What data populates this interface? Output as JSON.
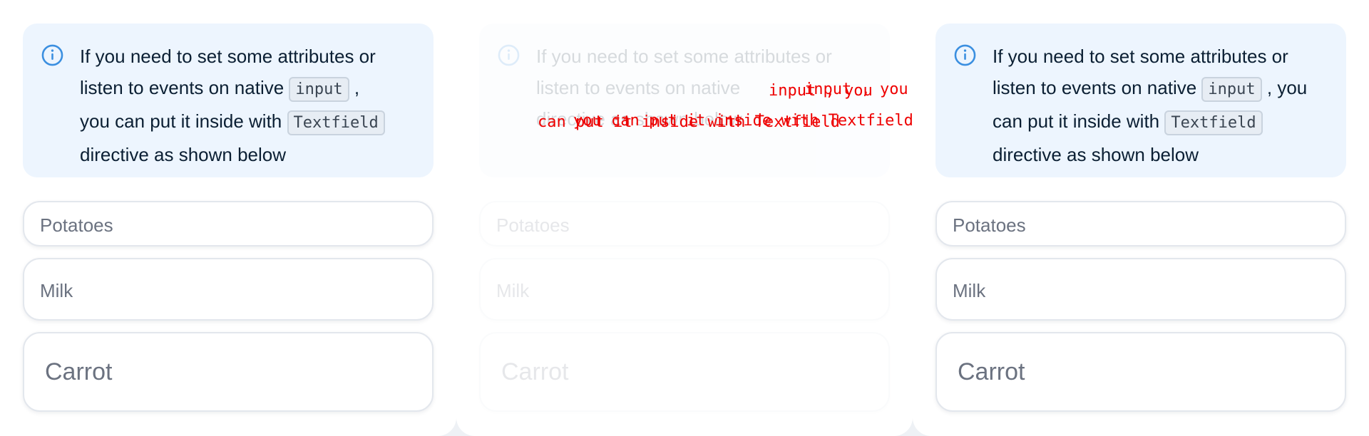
{
  "panels": [
    {
      "callout": {
        "line1": "If you need to set some attributes or",
        "line2": "listen to events on native",
        "code1": "input",
        "after_code1": ",",
        "line3": "you can put it inside with",
        "code2": "Textfield",
        "line4": "directive as shown below"
      },
      "fields": [
        "Potatoes",
        "Milk",
        "Carrot"
      ]
    },
    {
      "callout": {
        "line1": "If you need to set some attributes or",
        "line2": "listen to events on native",
        "line3": "",
        "line4": "directive as shown below"
      },
      "fields": [
        "Potatoes",
        "Milk",
        "Carrot"
      ],
      "overlay": {
        "row1_a": "input , you",
        "row1_b": "input , you",
        "row2_a": "you can put it inside with Textfield",
        "row2_b": "can put it inside with Textfield"
      }
    },
    {
      "callout": {
        "line1": "If you need to set some attributes or",
        "line2": "listen to events on native",
        "code1": "input",
        "after_code1": ", you",
        "line3": "can put it inside with",
        "code2": "Textfield",
        "line4": "directive as shown below"
      },
      "fields": [
        "Potatoes",
        "Milk",
        "Carrot"
      ]
    }
  ],
  "colors": {
    "callout_bg": "#edf5fe",
    "info_icon": "#3b8fe0",
    "diff_red": "#ee0000"
  },
  "icons": [
    "info-circle-icon"
  ]
}
